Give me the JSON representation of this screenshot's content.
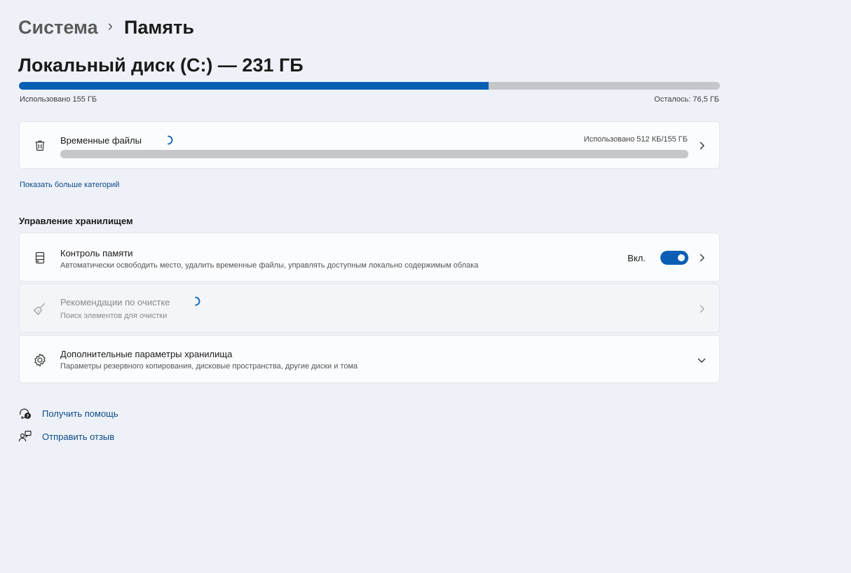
{
  "breadcrumb": {
    "parent": "Система",
    "separator": "›",
    "current": "Память"
  },
  "disk": {
    "title": "Локальный диск (C:) — 231 ГБ",
    "used_label": "Использовано 155 ГБ",
    "free_label": "Осталось: 76,5 ГБ",
    "used_fraction": 0.67,
    "bar_color": "#0a5fb5"
  },
  "temp_files": {
    "icon": "trash-icon",
    "title": "Временные файлы",
    "usage": "Использовано 512 КБ/155 ГБ",
    "used_fraction": 0.0
  },
  "more_categories_link": "Показать больше категорий",
  "storage_management": {
    "heading": "Управление хранилищем",
    "storage_sense": {
      "icon": "storage-drive-icon",
      "title": "Контроль памяти",
      "subtitle": "Автоматически освободить место, удалить временные файлы, управлять доступным локально содержимым облака",
      "toggle_label": "Вкл.",
      "toggle_on": true
    },
    "cleanup": {
      "icon": "broom-icon",
      "title": "Рекомендации по очистке",
      "subtitle": "Поиск элементов для очистки",
      "disabled": true
    },
    "advanced": {
      "icon": "gear-icon",
      "title": "Дополнительные параметры хранилища",
      "subtitle": "Параметры резервного копирования, дисковые пространства, другие диски и тома"
    }
  },
  "footer": {
    "help": "Получить помощь",
    "feedback": "Отправить отзыв"
  }
}
